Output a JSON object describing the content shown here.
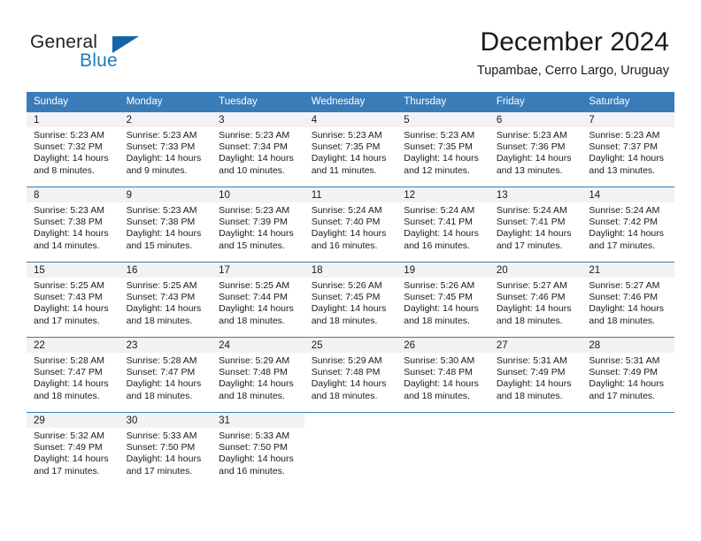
{
  "brand": {
    "name_part1": "General",
    "name_part2": "Blue",
    "triangle_icon": "triangle-logo-icon",
    "blue": "#1f7bc1",
    "dark_blue": "#1565a8"
  },
  "header": {
    "title": "December 2024",
    "subtitle": "Tupambae, Cerro Largo, Uruguay"
  },
  "calendar": {
    "header_bg": "#3a7cb8",
    "daynum_bg": "#f2f2f2",
    "weekday_headers": [
      "Sunday",
      "Monday",
      "Tuesday",
      "Wednesday",
      "Thursday",
      "Friday",
      "Saturday"
    ],
    "weeks": [
      [
        {
          "day": "1",
          "sunrise": "Sunrise: 5:23 AM",
          "sunset": "Sunset: 7:32 PM",
          "daylight_line1": "Daylight: 14 hours",
          "daylight_line2": "and 8 minutes."
        },
        {
          "day": "2",
          "sunrise": "Sunrise: 5:23 AM",
          "sunset": "Sunset: 7:33 PM",
          "daylight_line1": "Daylight: 14 hours",
          "daylight_line2": "and 9 minutes."
        },
        {
          "day": "3",
          "sunrise": "Sunrise: 5:23 AM",
          "sunset": "Sunset: 7:34 PM",
          "daylight_line1": "Daylight: 14 hours",
          "daylight_line2": "and 10 minutes."
        },
        {
          "day": "4",
          "sunrise": "Sunrise: 5:23 AM",
          "sunset": "Sunset: 7:35 PM",
          "daylight_line1": "Daylight: 14 hours",
          "daylight_line2": "and 11 minutes."
        },
        {
          "day": "5",
          "sunrise": "Sunrise: 5:23 AM",
          "sunset": "Sunset: 7:35 PM",
          "daylight_line1": "Daylight: 14 hours",
          "daylight_line2": "and 12 minutes."
        },
        {
          "day": "6",
          "sunrise": "Sunrise: 5:23 AM",
          "sunset": "Sunset: 7:36 PM",
          "daylight_line1": "Daylight: 14 hours",
          "daylight_line2": "and 13 minutes."
        },
        {
          "day": "7",
          "sunrise": "Sunrise: 5:23 AM",
          "sunset": "Sunset: 7:37 PM",
          "daylight_line1": "Daylight: 14 hours",
          "daylight_line2": "and 13 minutes."
        }
      ],
      [
        {
          "day": "8",
          "sunrise": "Sunrise: 5:23 AM",
          "sunset": "Sunset: 7:38 PM",
          "daylight_line1": "Daylight: 14 hours",
          "daylight_line2": "and 14 minutes."
        },
        {
          "day": "9",
          "sunrise": "Sunrise: 5:23 AM",
          "sunset": "Sunset: 7:38 PM",
          "daylight_line1": "Daylight: 14 hours",
          "daylight_line2": "and 15 minutes."
        },
        {
          "day": "10",
          "sunrise": "Sunrise: 5:23 AM",
          "sunset": "Sunset: 7:39 PM",
          "daylight_line1": "Daylight: 14 hours",
          "daylight_line2": "and 15 minutes."
        },
        {
          "day": "11",
          "sunrise": "Sunrise: 5:24 AM",
          "sunset": "Sunset: 7:40 PM",
          "daylight_line1": "Daylight: 14 hours",
          "daylight_line2": "and 16 minutes."
        },
        {
          "day": "12",
          "sunrise": "Sunrise: 5:24 AM",
          "sunset": "Sunset: 7:41 PM",
          "daylight_line1": "Daylight: 14 hours",
          "daylight_line2": "and 16 minutes."
        },
        {
          "day": "13",
          "sunrise": "Sunrise: 5:24 AM",
          "sunset": "Sunset: 7:41 PM",
          "daylight_line1": "Daylight: 14 hours",
          "daylight_line2": "and 17 minutes."
        },
        {
          "day": "14",
          "sunrise": "Sunrise: 5:24 AM",
          "sunset": "Sunset: 7:42 PM",
          "daylight_line1": "Daylight: 14 hours",
          "daylight_line2": "and 17 minutes."
        }
      ],
      [
        {
          "day": "15",
          "sunrise": "Sunrise: 5:25 AM",
          "sunset": "Sunset: 7:43 PM",
          "daylight_line1": "Daylight: 14 hours",
          "daylight_line2": "and 17 minutes."
        },
        {
          "day": "16",
          "sunrise": "Sunrise: 5:25 AM",
          "sunset": "Sunset: 7:43 PM",
          "daylight_line1": "Daylight: 14 hours",
          "daylight_line2": "and 18 minutes."
        },
        {
          "day": "17",
          "sunrise": "Sunrise: 5:25 AM",
          "sunset": "Sunset: 7:44 PM",
          "daylight_line1": "Daylight: 14 hours",
          "daylight_line2": "and 18 minutes."
        },
        {
          "day": "18",
          "sunrise": "Sunrise: 5:26 AM",
          "sunset": "Sunset: 7:45 PM",
          "daylight_line1": "Daylight: 14 hours",
          "daylight_line2": "and 18 minutes."
        },
        {
          "day": "19",
          "sunrise": "Sunrise: 5:26 AM",
          "sunset": "Sunset: 7:45 PM",
          "daylight_line1": "Daylight: 14 hours",
          "daylight_line2": "and 18 minutes."
        },
        {
          "day": "20",
          "sunrise": "Sunrise: 5:27 AM",
          "sunset": "Sunset: 7:46 PM",
          "daylight_line1": "Daylight: 14 hours",
          "daylight_line2": "and 18 minutes."
        },
        {
          "day": "21",
          "sunrise": "Sunrise: 5:27 AM",
          "sunset": "Sunset: 7:46 PM",
          "daylight_line1": "Daylight: 14 hours",
          "daylight_line2": "and 18 minutes."
        }
      ],
      [
        {
          "day": "22",
          "sunrise": "Sunrise: 5:28 AM",
          "sunset": "Sunset: 7:47 PM",
          "daylight_line1": "Daylight: 14 hours",
          "daylight_line2": "and 18 minutes."
        },
        {
          "day": "23",
          "sunrise": "Sunrise: 5:28 AM",
          "sunset": "Sunset: 7:47 PM",
          "daylight_line1": "Daylight: 14 hours",
          "daylight_line2": "and 18 minutes."
        },
        {
          "day": "24",
          "sunrise": "Sunrise: 5:29 AM",
          "sunset": "Sunset: 7:48 PM",
          "daylight_line1": "Daylight: 14 hours",
          "daylight_line2": "and 18 minutes."
        },
        {
          "day": "25",
          "sunrise": "Sunrise: 5:29 AM",
          "sunset": "Sunset: 7:48 PM",
          "daylight_line1": "Daylight: 14 hours",
          "daylight_line2": "and 18 minutes."
        },
        {
          "day": "26",
          "sunrise": "Sunrise: 5:30 AM",
          "sunset": "Sunset: 7:48 PM",
          "daylight_line1": "Daylight: 14 hours",
          "daylight_line2": "and 18 minutes."
        },
        {
          "day": "27",
          "sunrise": "Sunrise: 5:31 AM",
          "sunset": "Sunset: 7:49 PM",
          "daylight_line1": "Daylight: 14 hours",
          "daylight_line2": "and 18 minutes."
        },
        {
          "day": "28",
          "sunrise": "Sunrise: 5:31 AM",
          "sunset": "Sunset: 7:49 PM",
          "daylight_line1": "Daylight: 14 hours",
          "daylight_line2": "and 17 minutes."
        }
      ],
      [
        {
          "day": "29",
          "sunrise": "Sunrise: 5:32 AM",
          "sunset": "Sunset: 7:49 PM",
          "daylight_line1": "Daylight: 14 hours",
          "daylight_line2": "and 17 minutes."
        },
        {
          "day": "30",
          "sunrise": "Sunrise: 5:33 AM",
          "sunset": "Sunset: 7:50 PM",
          "daylight_line1": "Daylight: 14 hours",
          "daylight_line2": "and 17 minutes."
        },
        {
          "day": "31",
          "sunrise": "Sunrise: 5:33 AM",
          "sunset": "Sunset: 7:50 PM",
          "daylight_line1": "Daylight: 14 hours",
          "daylight_line2": "and 16 minutes."
        },
        {
          "day": "",
          "sunrise": "",
          "sunset": "",
          "daylight_line1": "",
          "daylight_line2": ""
        },
        {
          "day": "",
          "sunrise": "",
          "sunset": "",
          "daylight_line1": "",
          "daylight_line2": ""
        },
        {
          "day": "",
          "sunrise": "",
          "sunset": "",
          "daylight_line1": "",
          "daylight_line2": ""
        },
        {
          "day": "",
          "sunrise": "",
          "sunset": "",
          "daylight_line1": "",
          "daylight_line2": ""
        }
      ]
    ]
  }
}
